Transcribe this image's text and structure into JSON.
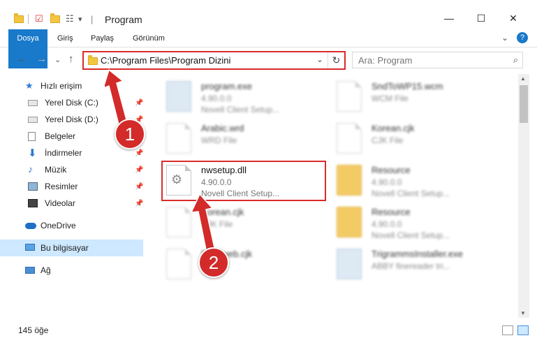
{
  "window": {
    "title": "Program",
    "minimize": "—",
    "maximize": "☐",
    "close": "✕"
  },
  "ribbon": {
    "tabs": [
      "Dosya",
      "Giriş",
      "Paylaş",
      "Görünüm"
    ],
    "expand": "⌄",
    "help": "?"
  },
  "nav": {
    "back": "←",
    "forward": "→",
    "recent": "⌄",
    "up": "↑"
  },
  "address": {
    "path": "C:\\Program Files\\Program Dizini",
    "dropdown": "⌄",
    "refresh": "↻"
  },
  "search": {
    "placeholder": "Ara: Program"
  },
  "sidebar": {
    "items": [
      {
        "label": "Hızlı erişim",
        "icon": "star-icon"
      },
      {
        "label": "Yerel Disk (C:)",
        "icon": "drive-icon",
        "pin": "📌"
      },
      {
        "label": "Yerel Disk (D:)",
        "icon": "drive-icon",
        "pin": "📌"
      },
      {
        "label": "Belgeler",
        "icon": "documents-icon",
        "pin": "📌"
      },
      {
        "label": "İndirmeler",
        "icon": "downloads-icon",
        "pin": "📌"
      },
      {
        "label": "Müzik",
        "icon": "music-icon",
        "pin": "📌"
      },
      {
        "label": "Resimler",
        "icon": "pictures-icon",
        "pin": "📌"
      },
      {
        "label": "Videolar",
        "icon": "videos-icon",
        "pin": "📌"
      },
      {
        "label": "OneDrive",
        "icon": "cloud-icon"
      },
      {
        "label": "Bu bilgisayar",
        "icon": "computer-icon"
      },
      {
        "label": "Ağ",
        "icon": "network-icon"
      }
    ]
  },
  "files": [
    {
      "name": "program.exe",
      "m1": "4.90.0.0",
      "m2": "Novell Client Setup...",
      "type": "exe"
    },
    {
      "name": "SndToWP15.wcm",
      "m1": "WCM File",
      "m2": "",
      "type": "doc"
    },
    {
      "name": "Arabic.wrd",
      "m1": "WRD File",
      "m2": "",
      "type": "doc"
    },
    {
      "name": "Korean.cjk",
      "m1": "CJK File",
      "m2": "",
      "type": "doc"
    },
    {
      "name": "nwsetup.dll",
      "m1": "4.90.0.0",
      "m2": "Novell Client Setup...",
      "type": "dll"
    },
    {
      "name": "Resource",
      "m1": "4.90.0.0",
      "m2": "Novell Client Setup...",
      "type": "folder"
    },
    {
      "name": "Korean.cjk",
      "m1": "CJK File",
      "m2": "",
      "type": "doc"
    },
    {
      "name": "Resource",
      "m1": "4.90.0.0",
      "m2": "Novell Client Setup...",
      "type": "folder"
    },
    {
      "name": "Feedweb.cjk",
      "m1": "",
      "m2": "",
      "type": "doc"
    },
    {
      "name": "TrigrammsInstaller.exe",
      "m1": "ABBY finereader tri...",
      "m2": "",
      "type": "exe"
    }
  ],
  "annotations": {
    "badge1": "1",
    "badge2": "2",
    "color": "#d32a2a"
  },
  "status": {
    "count": "145 öğe"
  },
  "colors": {
    "accent": "#1979ca",
    "highlight": "#d92b2b",
    "selected": "#cde8ff"
  }
}
